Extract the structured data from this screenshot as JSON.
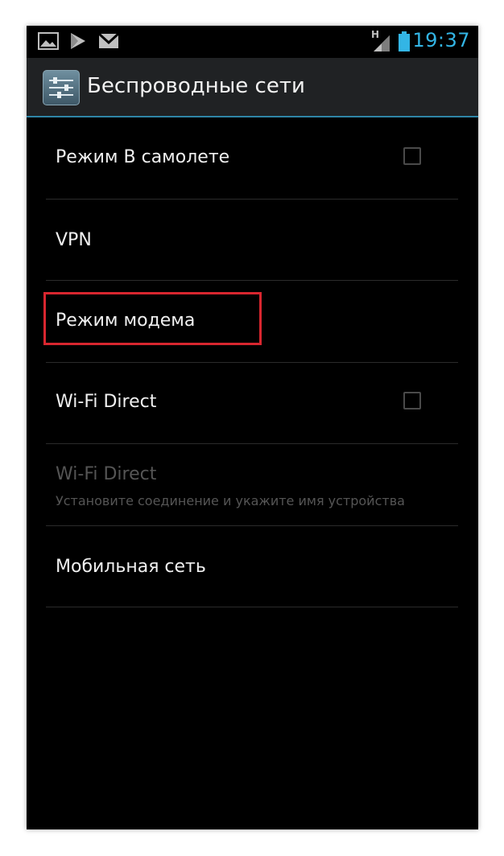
{
  "statusbar": {
    "time": "19:37",
    "network_letter": "H",
    "icons": [
      "picture-icon",
      "play-store-icon",
      "gmail-icon",
      "signal-icon",
      "battery-icon"
    ]
  },
  "actionbar": {
    "title": "Беспроводные сети",
    "icon": "settings-sliders-icon"
  },
  "items": [
    {
      "label": "Режим В самолете",
      "has_checkbox": true,
      "checked": false
    },
    {
      "label": "VPN",
      "has_checkbox": false
    },
    {
      "label": "Режим модема",
      "has_checkbox": false,
      "highlighted": true
    },
    {
      "label": "Wi-Fi Direct",
      "has_checkbox": true,
      "checked": false
    },
    {
      "label": "Wi-Fi Direct",
      "subtitle": "Установите соединение и укажите имя устройства",
      "disabled": true
    },
    {
      "label": "Мобильная сеть",
      "has_checkbox": false
    }
  ],
  "colors": {
    "accent": "#33b5e5",
    "highlight": "#d8262f",
    "background": "#000000"
  }
}
